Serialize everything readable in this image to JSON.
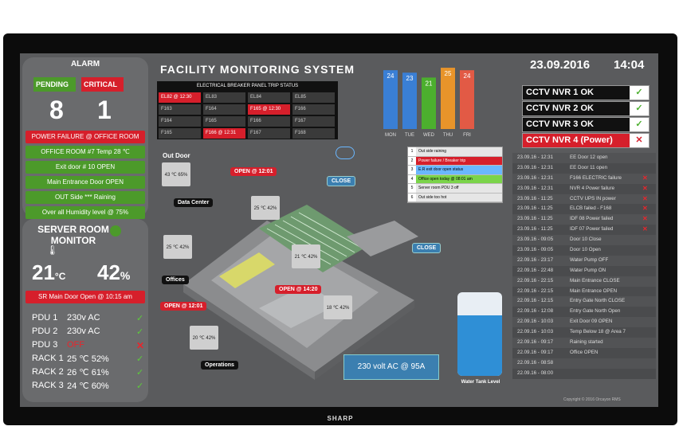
{
  "header": {
    "title": "FACILITY MONITORING SYSTEM",
    "date": "23.09.2016",
    "time": "14:04"
  },
  "alarm": {
    "title": "ALARM",
    "pending_label": "PENDING",
    "pending_count": "8",
    "critical_label": "CRITICAL",
    "critical_count": "1",
    "items": [
      {
        "text": "POWER FAILURE @ OFFICE ROOM",
        "status": "red"
      },
      {
        "text": "OFFICE ROOM #7  Temp     28 ℃",
        "status": "green"
      },
      {
        "text": "Exit door # 10       OPEN",
        "status": "green"
      },
      {
        "text": "Main Entrance Door   OPEN",
        "status": "green"
      },
      {
        "text": "OUT Side ***    Raining",
        "status": "green"
      },
      {
        "text": "Over all Humidity level  @  75%",
        "status": "green"
      }
    ]
  },
  "server_room": {
    "title": "SERVER ROOM MONITOR",
    "temp": "21",
    "temp_unit": "°C",
    "humidity": "42",
    "humidity_unit": "%",
    "door_alert": "SR Main Door Open @ 10:15 am",
    "devices": [
      {
        "name": "PDU 1",
        "value": "230v AC",
        "ok": true
      },
      {
        "name": "PDU 2",
        "value": "230v AC",
        "ok": true
      },
      {
        "name": "PDU 3",
        "value": "OFF",
        "ok": false
      },
      {
        "name": "RACK 1",
        "value": "25 ℃ 52%",
        "ok": true
      },
      {
        "name": "RACK 2",
        "value": "26 ℃ 61%",
        "ok": true
      },
      {
        "name": "RACK 3",
        "value": "24 ℃ 60%",
        "ok": true
      }
    ]
  },
  "breaker": {
    "title": "ELECTRICAL BREAKER PANEL TRIP STATUS",
    "cells": [
      {
        "label": "EL82 @ 12:30",
        "alarm": true
      },
      {
        "label": "EL83",
        "alarm": false
      },
      {
        "label": "EL84",
        "alarm": false
      },
      {
        "label": "EL85",
        "alarm": false
      },
      {
        "label": "F163",
        "alarm": false
      },
      {
        "label": "F164",
        "alarm": false
      },
      {
        "label": "F165 @ 12:30",
        "alarm": true
      },
      {
        "label": "F166",
        "alarm": false
      },
      {
        "label": "F164",
        "alarm": false
      },
      {
        "label": "F165",
        "alarm": false
      },
      {
        "label": "F166",
        "alarm": false
      },
      {
        "label": "F167",
        "alarm": false
      },
      {
        "label": "F165",
        "alarm": false
      },
      {
        "label": "F166 @ 12:31",
        "alarm": true
      },
      {
        "label": "F167",
        "alarm": false
      },
      {
        "label": "F168",
        "alarm": false
      }
    ]
  },
  "chart_data": {
    "type": "bar",
    "categories": [
      "MON",
      "TUE",
      "WED",
      "THU",
      "FRI"
    ],
    "values": [
      24,
      23,
      21,
      25,
      24
    ],
    "colors": [
      "#3a7fd5",
      "#3a7fd5",
      "#4caf2e",
      "#e8942a",
      "#e25a45"
    ],
    "title": "",
    "xlabel": "",
    "ylabel": ""
  },
  "nvr": [
    {
      "label": "CCTV  NVR 1   OK",
      "ok": true
    },
    {
      "label": "CCTV  NVR 2   OK",
      "ok": true
    },
    {
      "label": "CCTV  NVR 3   OK",
      "ok": true
    },
    {
      "label": "CCTV  NVR 4  (Power)",
      "ok": false
    }
  ],
  "event_log": [
    {
      "date": "23.09.16 - 12:31",
      "msg": "EE Door 12  open",
      "alarm": false
    },
    {
      "date": "23.09.16 - 12:31",
      "msg": "EE Door 11  open",
      "alarm": false
    },
    {
      "date": "23.09.16 - 12:31",
      "msg": "F166  ELECTRIC failure",
      "alarm": true
    },
    {
      "date": "23.09.16 - 12:31",
      "msg": "NVR 4 Power failure",
      "alarm": true
    },
    {
      "date": "23.09.16 - 11:25",
      "msg": "CCTV UPS IN power",
      "alarm": true
    },
    {
      "date": "23.09.16 - 11:25",
      "msg": "ELCB failed  - F168",
      "alarm": true
    },
    {
      "date": "23.09.16 - 11:25",
      "msg": "IDF 08 Power failed",
      "alarm": true
    },
    {
      "date": "23.09.16 - 11:25",
      "msg": "IDF 07 Power failed",
      "alarm": true
    },
    {
      "date": "23.09.16 - 09:05",
      "msg": "Door 10 Close",
      "alarm": false
    },
    {
      "date": "23.09.16 - 09:05",
      "msg": "Door 10 Open",
      "alarm": false
    },
    {
      "date": "22.09.16 - 23:17",
      "msg": "Water Pump OFF",
      "alarm": false
    },
    {
      "date": "22.09.16 - 22:48",
      "msg": "Water Pump ON",
      "alarm": false
    },
    {
      "date": "22.09.16 - 22:15",
      "msg": "Main Entrance CLOSE",
      "alarm": false
    },
    {
      "date": "22.09.16 - 22:15",
      "msg": "Main Entrance  OPEN",
      "alarm": false
    },
    {
      "date": "22.09.16 - 12:15",
      "msg": "Entry Gate North  CLOSE",
      "alarm": false
    },
    {
      "date": "22.09.16 - 12:08",
      "msg": "Entry Gate North  Open",
      "alarm": false
    },
    {
      "date": "22.09.16 - 10:03",
      "msg": "Exit Door 09 OPEN",
      "alarm": false
    },
    {
      "date": "22.09.16 - 10:03",
      "msg": "Temp Below 18  @ Area 7",
      "alarm": false
    },
    {
      "date": "22.09.16 - 09:17",
      "msg": "Raining started",
      "alarm": false
    },
    {
      "date": "22.09.16 - 09:17",
      "msg": "Office OPEN",
      "alarm": false
    },
    {
      "date": "22.09.16 - 08:58",
      "msg": "",
      "alarm": false
    },
    {
      "date": "22.09.16 - 08:00",
      "msg": "",
      "alarm": false
    }
  ],
  "legend": [
    {
      "num": "1",
      "text": "Out side raining",
      "color": "#e6e6e6"
    },
    {
      "num": "2",
      "text": "Power failure / Breaker trip",
      "color": "#d61f2b"
    },
    {
      "num": "3",
      "text": "E.R exit door open status",
      "color": "#6ab7ff"
    },
    {
      "num": "4",
      "text": "Office open today @ 08:01 am",
      "color": "#7bd44a"
    },
    {
      "num": "5",
      "text": "Server room  PDU 3 off",
      "color": "#e6e6e6"
    },
    {
      "num": "6",
      "text": "Out side too hot",
      "color": "#e6e6e6"
    }
  ],
  "map": {
    "out_door": "Out Door",
    "out_door_temp": "43 ℃   65%",
    "data_center": "Data Center",
    "offices": "Offices",
    "operations": "Operations",
    "open1": "OPEN @ 12:01",
    "open2": "OPEN @ 14:20",
    "open3": "OPEN @ 12:01",
    "close1": "CLOSE",
    "close2": "CLOSE",
    "s1": "25 ℃  42%",
    "s2": "25 ℃  42%",
    "s3": "21 ℃  42%",
    "s4": "18 ℃  42%",
    "s5": "20 ℃  42%",
    "ac": "230 volt AC  @ 95A",
    "tank": "Water Tank Level"
  },
  "footer": {
    "copyright": "Copyright © 2016 Orcayon RMS"
  },
  "brand": "SHARP"
}
